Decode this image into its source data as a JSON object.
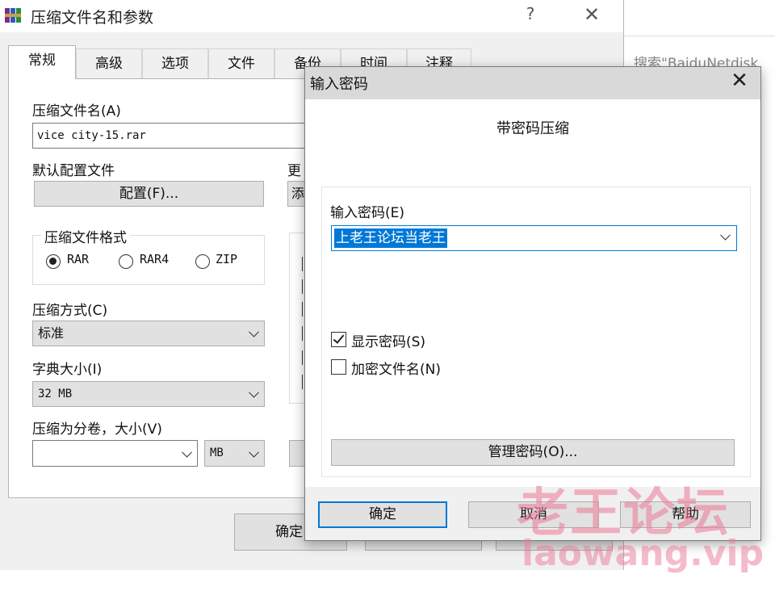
{
  "background": {
    "search_text": "搜索\"BaiduNetdisk"
  },
  "main_dialog": {
    "title": "压缩文件名和参数",
    "help_label": "?",
    "close_label": "✕",
    "tabs": [
      "常规",
      "高级",
      "选项",
      "文件",
      "备份",
      "时间",
      "注释"
    ],
    "active_tab": "常规",
    "archive_name_label": "压缩文件名(A)",
    "archive_name_value": "vice city-15.rar",
    "default_profile_label": "默认配置文件",
    "profile_button": "配置(F)...",
    "update_mode_label": "更",
    "update_combo_partial": "添",
    "format_group_label": "压缩文件格式",
    "formats": [
      "RAR",
      "RAR4",
      "ZIP"
    ],
    "selected_format": "RAR",
    "method_label": "压缩方式(C)",
    "method_value": "标准",
    "dict_label": "字典大小(I)",
    "dict_value": "32 MB",
    "split_label": "压缩为分卷，大小(V)",
    "split_value": "",
    "split_unit": "MB",
    "ok_partial": "确定"
  },
  "password_dialog": {
    "title": "输入密码",
    "close_label": "✕",
    "heading": "带密码压缩",
    "input_label": "输入密码(E)",
    "input_value": "上老王论坛当老王",
    "show_password_label": "显示密码(S)",
    "show_password_checked": true,
    "encrypt_names_label": "加密文件名(N)",
    "encrypt_names_checked": false,
    "manage_button": "管理密码(O)...",
    "ok_button": "确定",
    "cancel_button": "取消",
    "help_button": "帮助"
  },
  "watermark": {
    "cn": "老王论坛",
    "en": "laowang.vip"
  }
}
